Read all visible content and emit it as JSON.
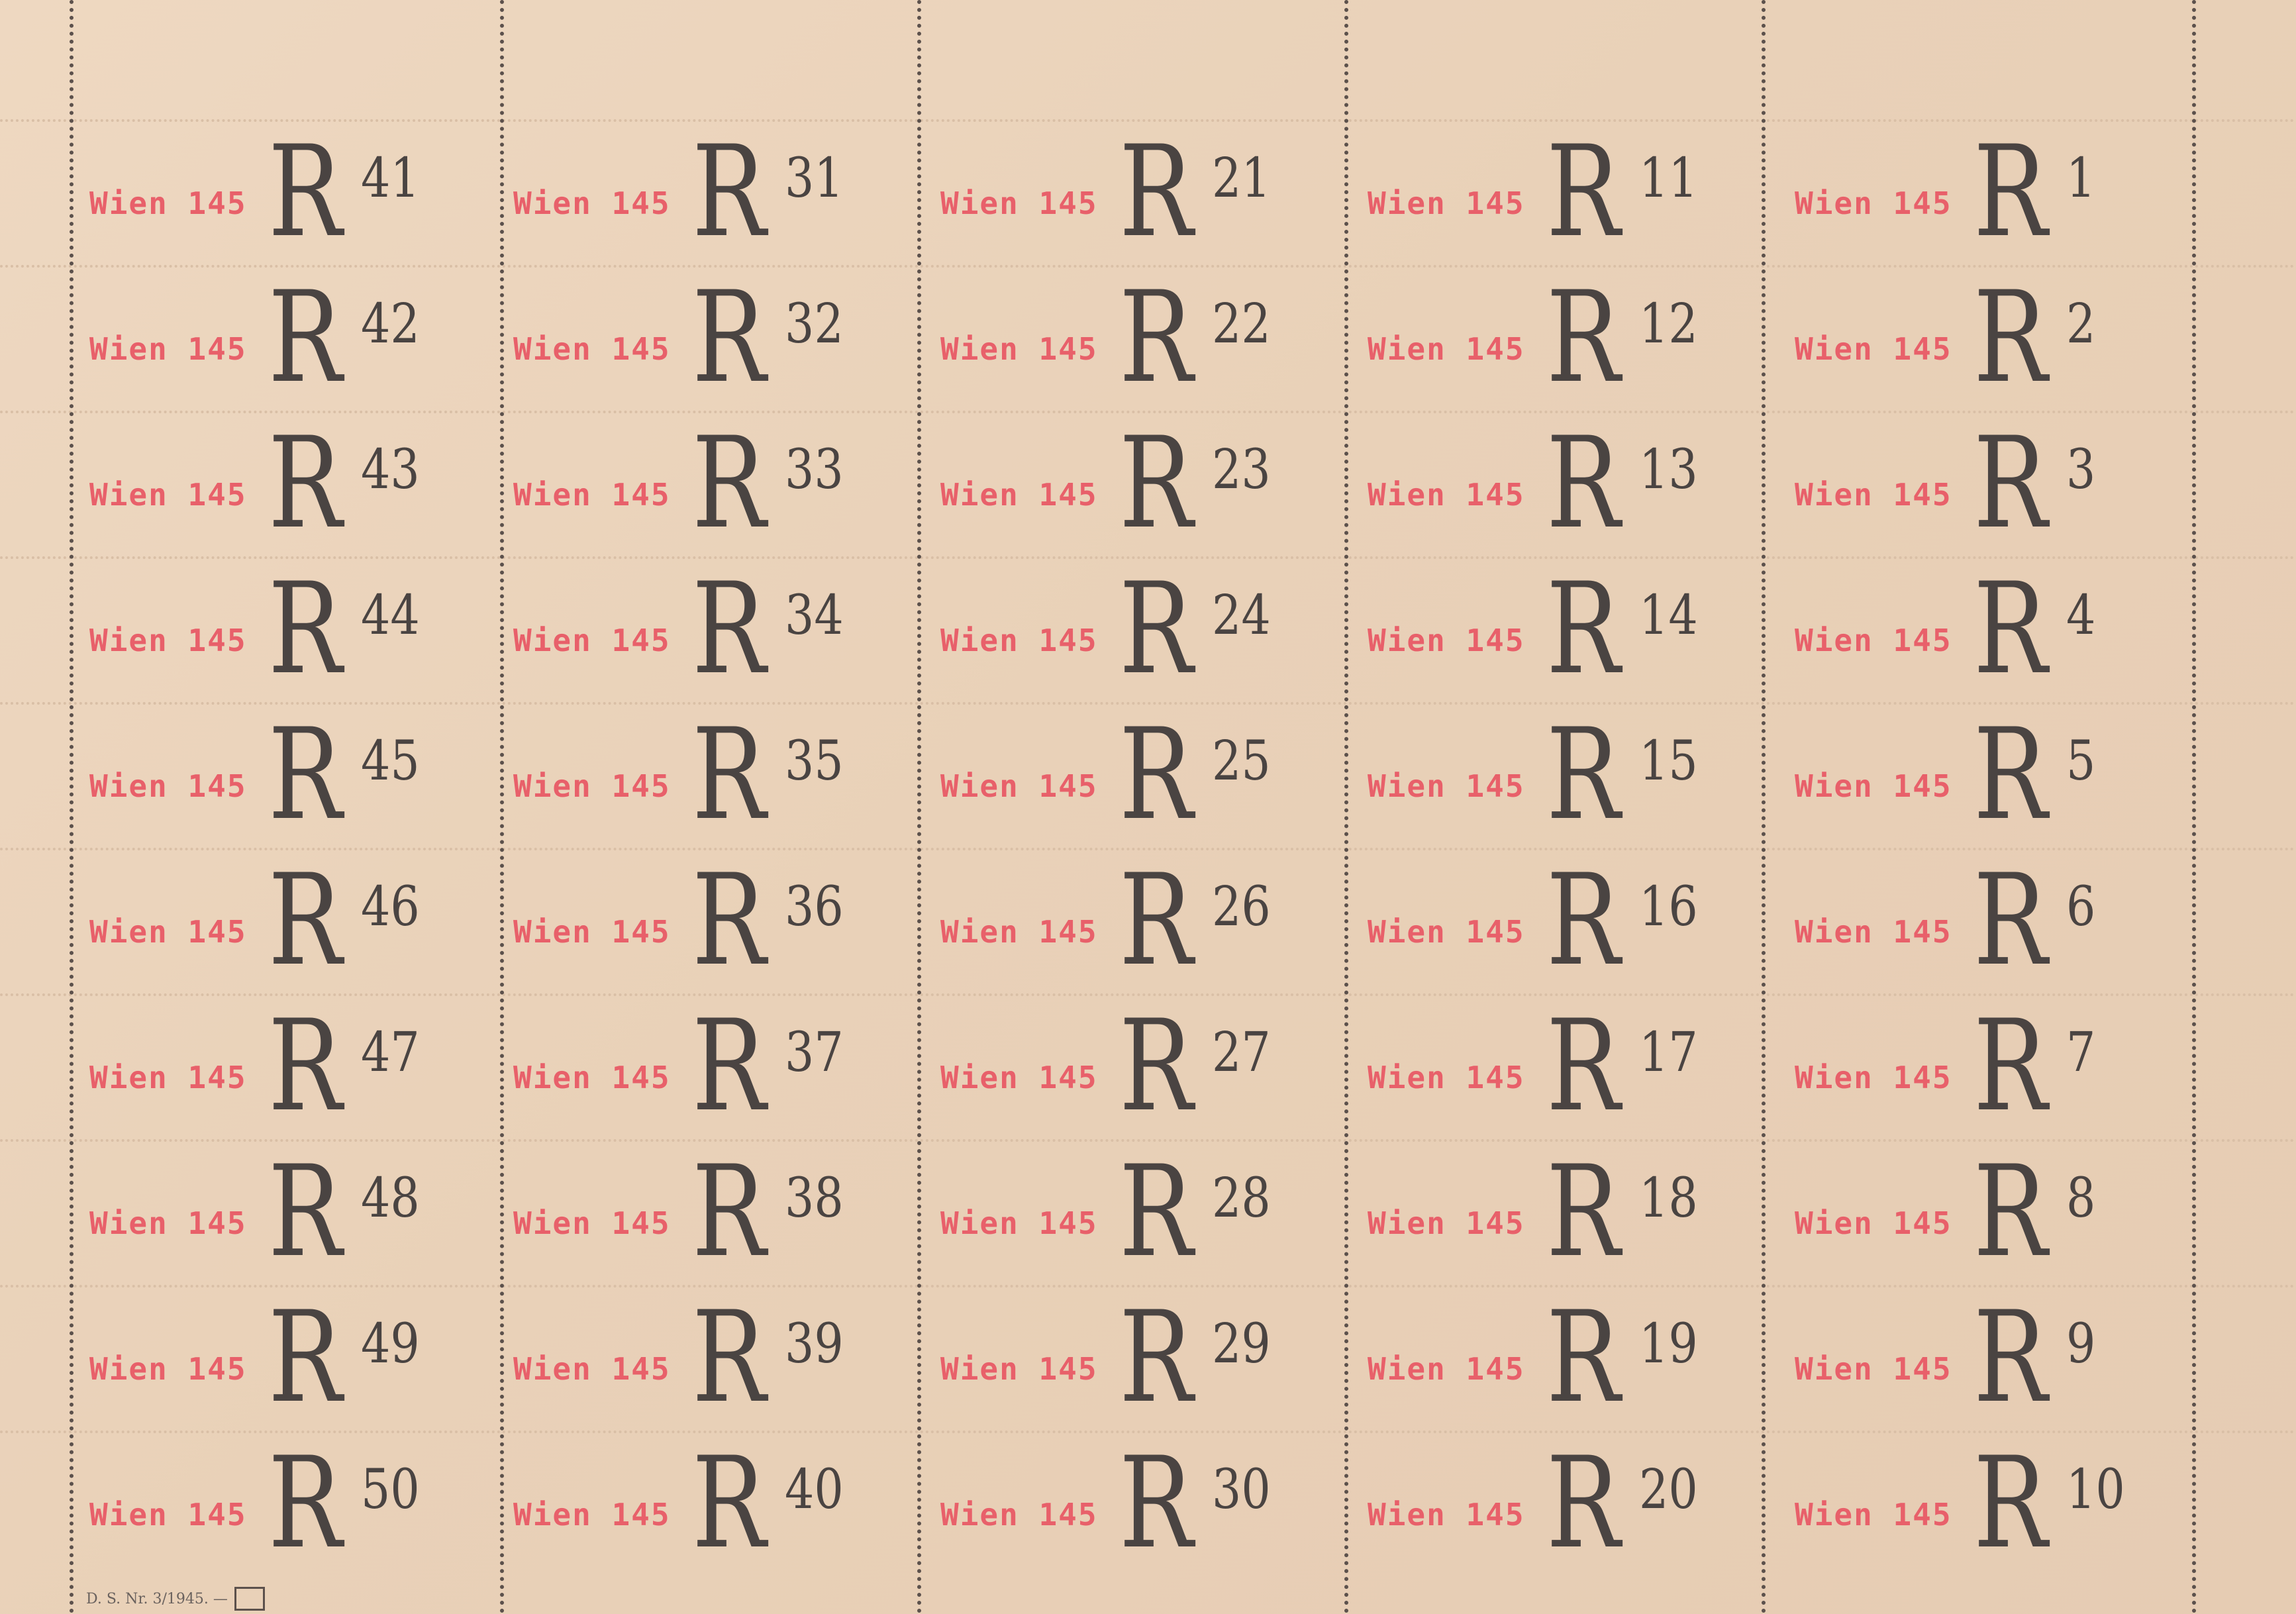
{
  "sheet": {
    "footer_text": "D. S. Nr. 3/1945. —",
    "columns": [
      {
        "stamps": [
          {
            "place": "Wien 145",
            "letter": "R",
            "number": "41"
          },
          {
            "place": "Wien 145",
            "letter": "R",
            "number": "42"
          },
          {
            "place": "Wien 145",
            "letter": "R",
            "number": "43"
          },
          {
            "place": "Wien 145",
            "letter": "R",
            "number": "44"
          },
          {
            "place": "Wien 145",
            "letter": "R",
            "number": "45"
          },
          {
            "place": "Wien 145",
            "letter": "R",
            "number": "46"
          },
          {
            "place": "Wien 145",
            "letter": "R",
            "number": "47"
          },
          {
            "place": "Wien 145",
            "letter": "R",
            "number": "48"
          },
          {
            "place": "Wien 145",
            "letter": "R",
            "number": "49"
          },
          {
            "place": "Wien 145",
            "letter": "R",
            "number": "50"
          }
        ]
      },
      {
        "stamps": [
          {
            "place": "Wien 145",
            "letter": "R",
            "number": "31"
          },
          {
            "place": "Wien 145",
            "letter": "R",
            "number": "32"
          },
          {
            "place": "Wien 145",
            "letter": "R",
            "number": "33"
          },
          {
            "place": "Wien 145",
            "letter": "R",
            "number": "34"
          },
          {
            "place": "Wien 145",
            "letter": "R",
            "number": "35"
          },
          {
            "place": "Wien 145",
            "letter": "R",
            "number": "36"
          },
          {
            "place": "Wien 145",
            "letter": "R",
            "number": "37"
          },
          {
            "place": "Wien 145",
            "letter": "R",
            "number": "38"
          },
          {
            "place": "Wien 145",
            "letter": "R",
            "number": "39"
          },
          {
            "place": "Wien 145",
            "letter": "R",
            "number": "40"
          }
        ]
      },
      {
        "stamps": [
          {
            "place": "Wien 145",
            "letter": "R",
            "number": "21"
          },
          {
            "place": "Wien 145",
            "letter": "R",
            "number": "22"
          },
          {
            "place": "Wien 145",
            "letter": "R",
            "number": "23"
          },
          {
            "place": "Wien 145",
            "letter": "R",
            "number": "24"
          },
          {
            "place": "Wien 145",
            "letter": "R",
            "number": "25"
          },
          {
            "place": "Wien 145",
            "letter": "R",
            "number": "26"
          },
          {
            "place": "Wien 145",
            "letter": "R",
            "number": "27"
          },
          {
            "place": "Wien 145",
            "letter": "R",
            "number": "28"
          },
          {
            "place": "Wien 145",
            "letter": "R",
            "number": "29"
          },
          {
            "place": "Wien 145",
            "letter": "R",
            "number": "30"
          }
        ]
      },
      {
        "stamps": [
          {
            "place": "Wien 145",
            "letter": "R",
            "number": "11"
          },
          {
            "place": "Wien 145",
            "letter": "R",
            "number": "12"
          },
          {
            "place": "Wien 145",
            "letter": "R",
            "number": "13"
          },
          {
            "place": "Wien 145",
            "letter": "R",
            "number": "14"
          },
          {
            "place": "Wien 145",
            "letter": "R",
            "number": "15"
          },
          {
            "place": "Wien 145",
            "letter": "R",
            "number": "16"
          },
          {
            "place": "Wien 145",
            "letter": "R",
            "number": "17"
          },
          {
            "place": "Wien 145",
            "letter": "R",
            "number": "18"
          },
          {
            "place": "Wien 145",
            "letter": "R",
            "number": "19"
          },
          {
            "place": "Wien 145",
            "letter": "R",
            "number": "20"
          }
        ]
      },
      {
        "stamps": [
          {
            "place": "Wien 145",
            "letter": "R",
            "number": "1"
          },
          {
            "place": "Wien 145",
            "letter": "R",
            "number": "2"
          },
          {
            "place": "Wien 145",
            "letter": "R",
            "number": "3"
          },
          {
            "place": "Wien 145",
            "letter": "R",
            "number": "4"
          },
          {
            "place": "Wien 145",
            "letter": "R",
            "number": "5"
          },
          {
            "place": "Wien 145",
            "letter": "R",
            "number": "6"
          },
          {
            "place": "Wien 145",
            "letter": "R",
            "number": "7"
          },
          {
            "place": "Wien 145",
            "letter": "R",
            "number": "8"
          },
          {
            "place": "Wien 145",
            "letter": "R",
            "number": "9"
          },
          {
            "place": "Wien 145",
            "letter": "R",
            "number": "10"
          }
        ]
      }
    ],
    "colors": {
      "paper": "#ead3bb",
      "place_red": "#e8606a",
      "print_dark": "#4a4442"
    }
  }
}
